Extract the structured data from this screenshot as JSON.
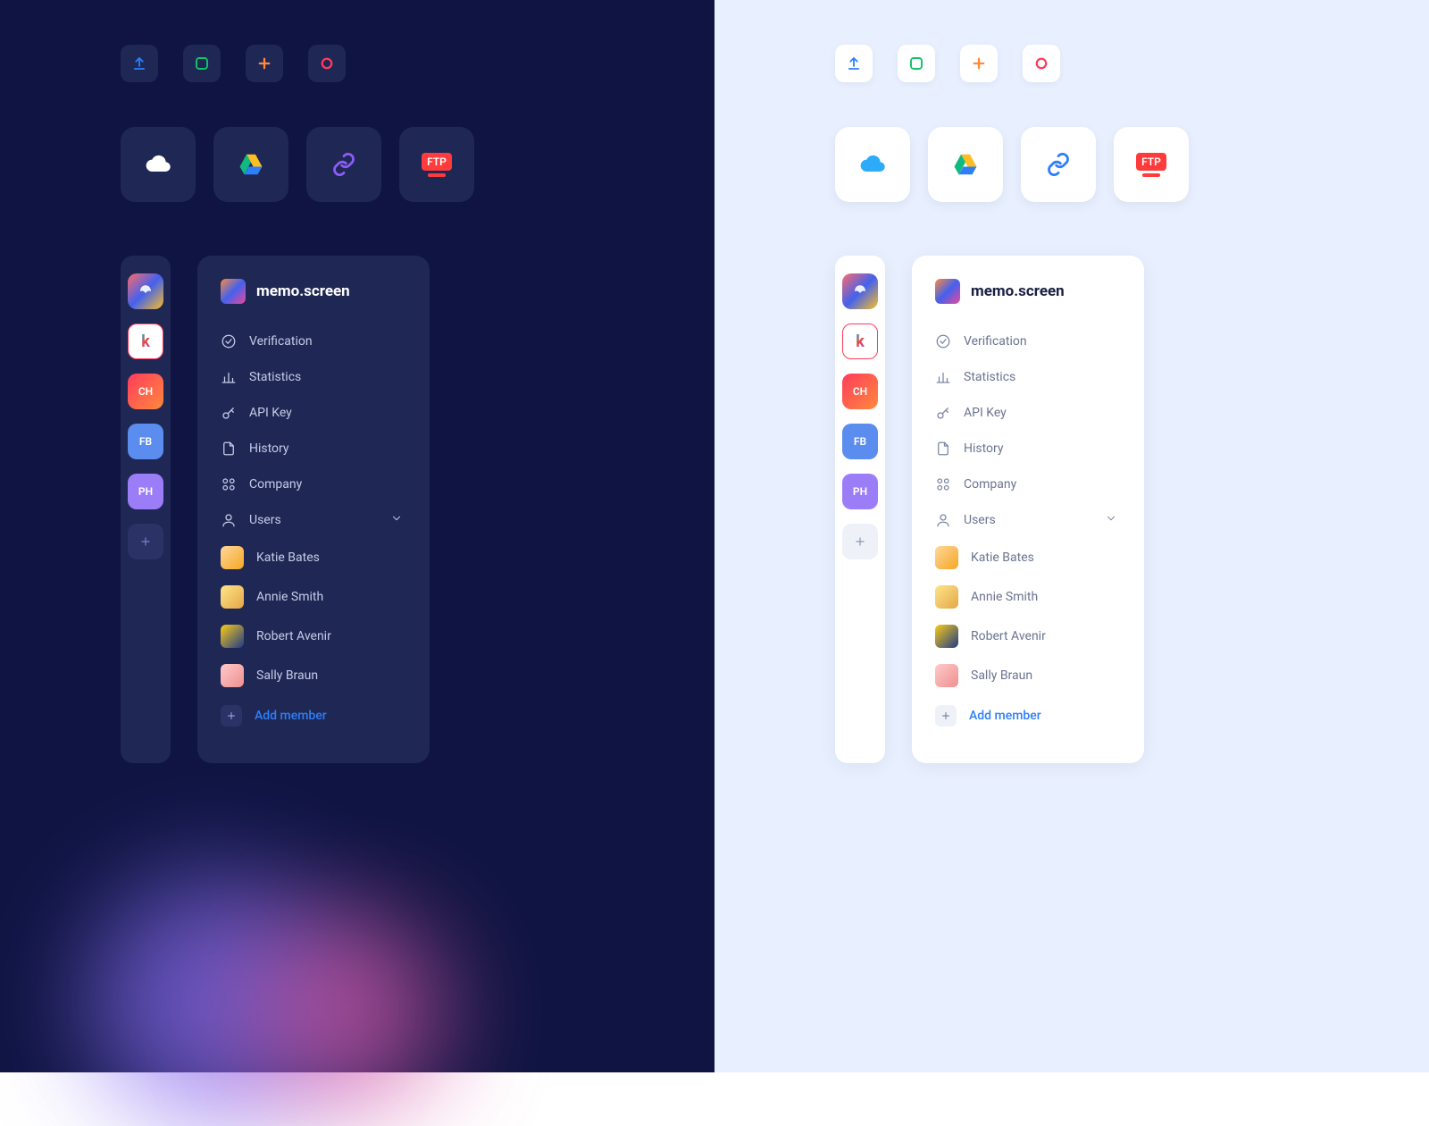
{
  "icons": [
    "upload",
    "square",
    "plus",
    "circle"
  ],
  "storage": [
    "cloud",
    "drive",
    "link",
    "ftp"
  ],
  "workspaces": [
    {
      "id": "logo",
      "label": ""
    },
    {
      "id": "k",
      "label": "K"
    },
    {
      "id": "ch",
      "label": "CH"
    },
    {
      "id": "fb",
      "label": "FB"
    },
    {
      "id": "ph",
      "label": "PH"
    }
  ],
  "panel": {
    "title": "memo.screen",
    "nav": [
      {
        "icon": "check-circle",
        "label": "Verification"
      },
      {
        "icon": "bar-chart",
        "label": "Statistics"
      },
      {
        "icon": "key",
        "label": "API Key"
      },
      {
        "icon": "file",
        "label": "History"
      },
      {
        "icon": "grid",
        "label": "Company"
      },
      {
        "icon": "user",
        "label": "Users",
        "expandable": true
      }
    ],
    "users": [
      {
        "name": "Katie Bates"
      },
      {
        "name": "Annie Smith"
      },
      {
        "name": "Robert Avenir"
      },
      {
        "name": "Sally Braun"
      }
    ],
    "add_member": "Add member"
  },
  "ftp_label": "FTP"
}
